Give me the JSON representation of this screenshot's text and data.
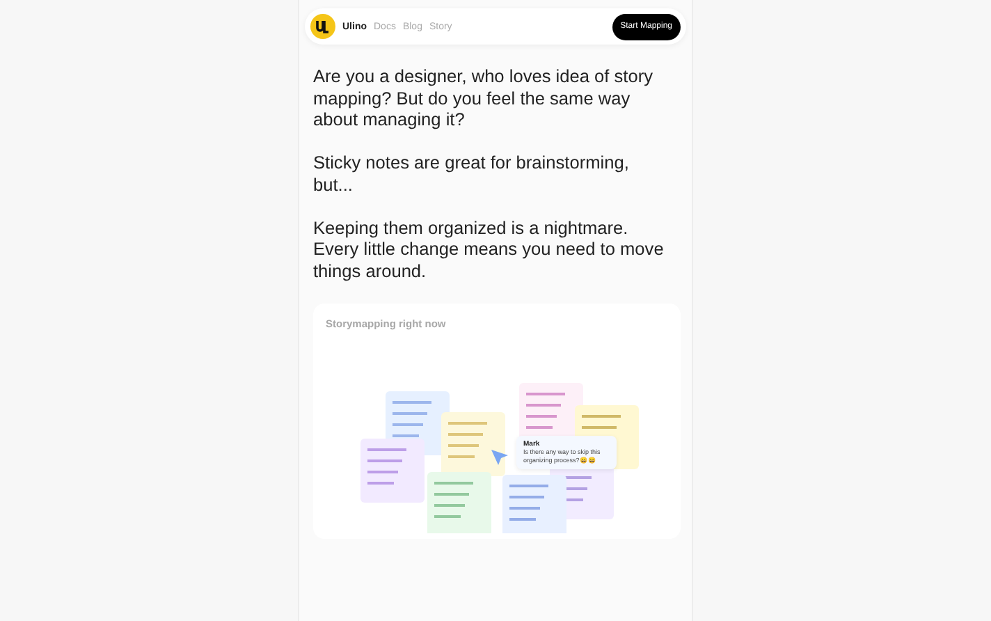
{
  "header": {
    "logo": "Ulino",
    "nav": [
      {
        "label": "Docs"
      },
      {
        "label": "Blog"
      },
      {
        "label": "Story"
      }
    ],
    "cta": "Start Mapping"
  },
  "paragraphs": [
    "Are you a designer, who loves idea of story mapping? But do you feel the same way about managing it?",
    "Sticky notes are great for brainstorming, but...",
    "Keeping them organized is a nightmare. Every little change means you need to move things around."
  ],
  "card": {
    "title": "Storymapping right now",
    "comment": {
      "author": "Mark",
      "text": "Is there any way to skip this organizing process?😀😀"
    }
  }
}
